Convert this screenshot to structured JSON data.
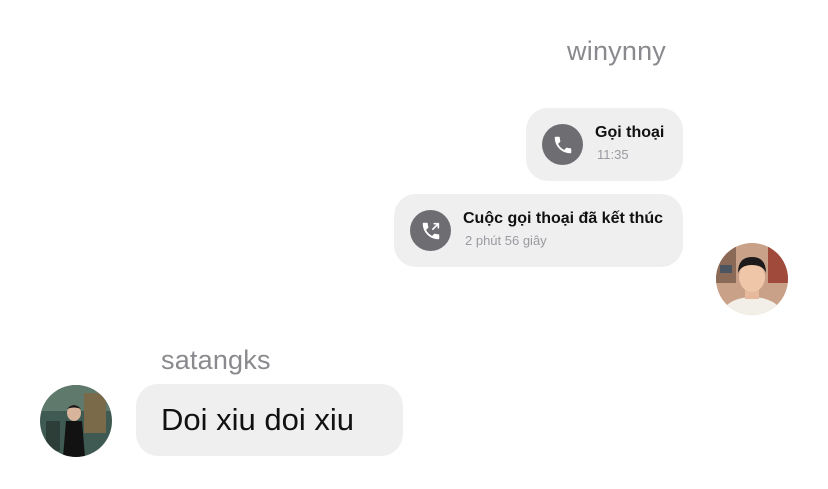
{
  "conversation": {
    "right_sender": "winynny",
    "left_sender": "satangks",
    "call_started": {
      "title": "Gọi thoại",
      "time": "11:35",
      "icon": "phone-icon"
    },
    "call_ended": {
      "title": "Cuộc gọi thoại đã kết thúc",
      "duration": "2 phút 56 giây",
      "icon": "phone-outgoing-icon"
    },
    "message": {
      "text": "Doi xiu doi xiu"
    }
  },
  "colors": {
    "bubble": "#efeff0",
    "icon_bg": "#6d6d72",
    "sender_name": "#8a8a8e",
    "muted_text": "#9a9aa0"
  }
}
